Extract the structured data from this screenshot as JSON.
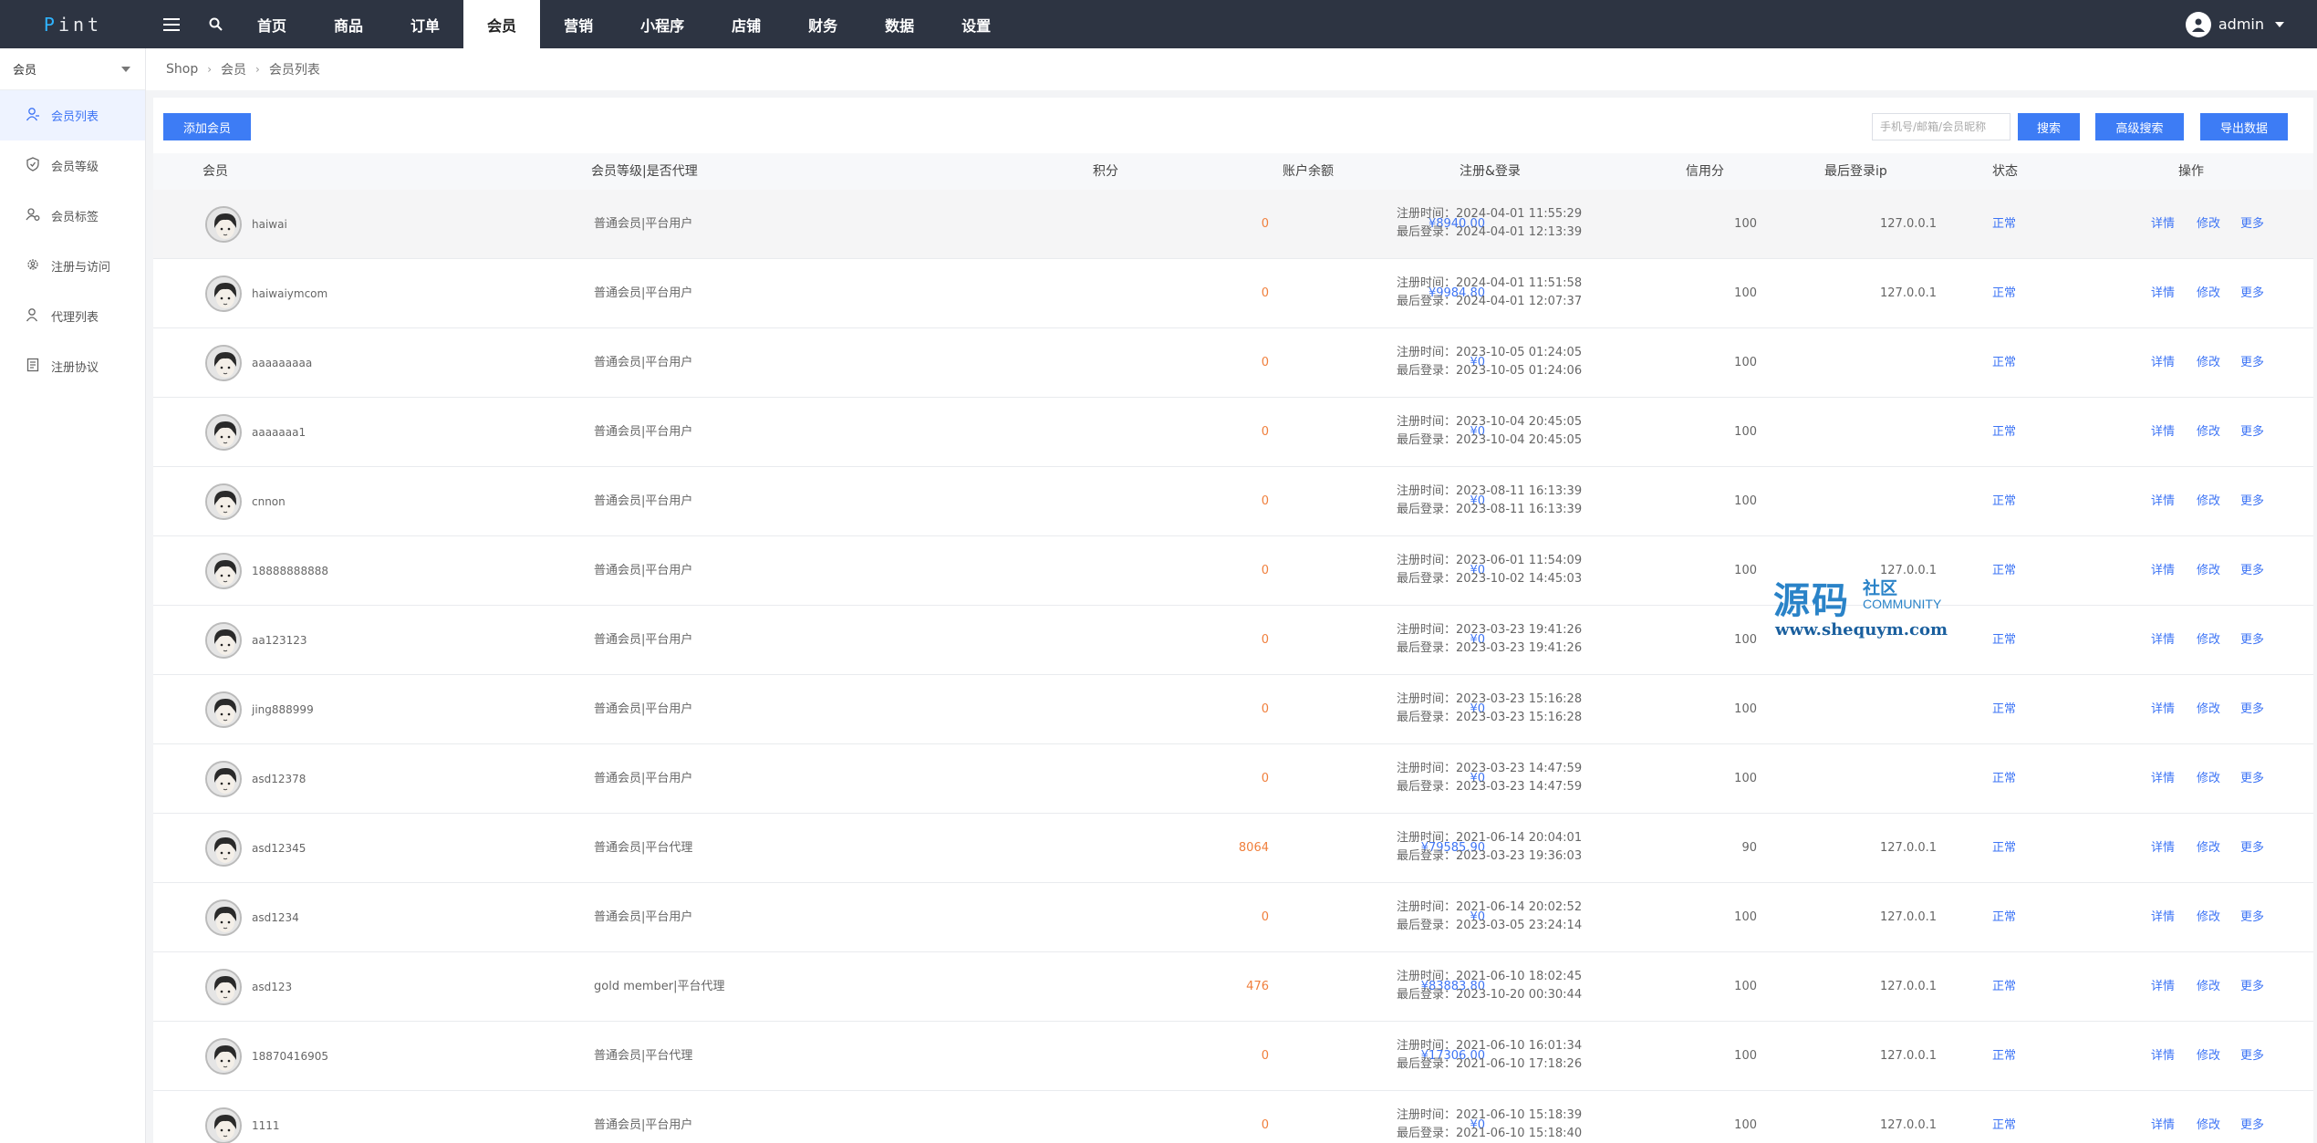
{
  "logo": "Pint",
  "nav": [
    "首页",
    "商品",
    "订单",
    "会员",
    "营销",
    "小程序",
    "店铺",
    "财务",
    "数据",
    "设置"
  ],
  "nav_active": 3,
  "user": "admin",
  "sidebar": {
    "header": "会员",
    "items": [
      {
        "label": "会员列表",
        "icon": "user-icon"
      },
      {
        "label": "会员等级",
        "icon": "shield-icon"
      },
      {
        "label": "会员标签",
        "icon": "user-tag-icon"
      },
      {
        "label": "注册与访问",
        "icon": "gear-user-icon"
      },
      {
        "label": "代理列表",
        "icon": "agent-icon"
      },
      {
        "label": "注册协议",
        "icon": "document-icon"
      }
    ]
  },
  "breadcrumb": [
    "Shop",
    "会员",
    "会员列表"
  ],
  "toolbar": {
    "add_label": "添加会员",
    "search_placeholder": "手机号/邮箱/会员昵称",
    "search_label": "搜索",
    "advanced_label": "高级搜索",
    "export_label": "导出数据"
  },
  "table": {
    "headers": [
      "会员",
      "会员等级|是否代理",
      "积分",
      "账户余额",
      "注册&登录",
      "信用分",
      "最后登录ip",
      "状态",
      "操作"
    ],
    "reg_prefix": "注册时间：",
    "login_prefix": "最后登录：",
    "actions": [
      "详情",
      "修改",
      "更多"
    ],
    "rows": [
      {
        "name": "haiwai",
        "level": "普通会员|平台用户",
        "points": "0",
        "balance": "¥8940.00",
        "reg": "2024-04-01 11:55:29",
        "login": "2024-04-01 12:13:39",
        "credit": "100",
        "ip": "127.0.0.1",
        "status": "正常"
      },
      {
        "name": "haiwaiymcom",
        "level": "普通会员|平台用户",
        "points": "0",
        "balance": "¥9984.80",
        "reg": "2024-04-01 11:51:58",
        "login": "2024-04-01 12:07:37",
        "credit": "100",
        "ip": "127.0.0.1",
        "status": "正常"
      },
      {
        "name": "aaaaaaaaa",
        "level": "普通会员|平台用户",
        "points": "0",
        "balance": "¥0",
        "reg": "2023-10-05 01:24:05",
        "login": "2023-10-05 01:24:06",
        "credit": "100",
        "ip": "",
        "status": "正常"
      },
      {
        "name": "aaaaaaa1",
        "level": "普通会员|平台用户",
        "points": "0",
        "balance": "¥0",
        "reg": "2023-10-04 20:45:05",
        "login": "2023-10-04 20:45:05",
        "credit": "100",
        "ip": "",
        "status": "正常"
      },
      {
        "name": "cnnon",
        "level": "普通会员|平台用户",
        "points": "0",
        "balance": "¥0",
        "reg": "2023-08-11 16:13:39",
        "login": "2023-08-11 16:13:39",
        "credit": "100",
        "ip": "",
        "status": "正常"
      },
      {
        "name": "18888888888",
        "level": "普通会员|平台用户",
        "points": "0",
        "balance": "¥0",
        "reg": "2023-06-01 11:54:09",
        "login": "2023-10-02 14:45:03",
        "credit": "100",
        "ip": "127.0.0.1",
        "status": "正常"
      },
      {
        "name": "aa123123",
        "level": "普通会员|平台用户",
        "points": "0",
        "balance": "¥0",
        "reg": "2023-03-23 19:41:26",
        "login": "2023-03-23 19:41:26",
        "credit": "100",
        "ip": "",
        "status": "正常"
      },
      {
        "name": "jing888999",
        "level": "普通会员|平台用户",
        "points": "0",
        "balance": "¥0",
        "reg": "2023-03-23 15:16:28",
        "login": "2023-03-23 15:16:28",
        "credit": "100",
        "ip": "",
        "status": "正常"
      },
      {
        "name": "asd12378",
        "level": "普通会员|平台用户",
        "points": "0",
        "balance": "¥0",
        "reg": "2023-03-23 14:47:59",
        "login": "2023-03-23 14:47:59",
        "credit": "100",
        "ip": "",
        "status": "正常"
      },
      {
        "name": "asd12345",
        "level": "普通会员|平台代理",
        "points": "8064",
        "balance": "¥79585.90",
        "reg": "2021-06-14 20:04:01",
        "login": "2023-03-23 19:36:03",
        "credit": "90",
        "ip": "127.0.0.1",
        "status": "正常"
      },
      {
        "name": "asd1234",
        "level": "普通会员|平台用户",
        "points": "0",
        "balance": "¥0",
        "reg": "2021-06-14 20:02:52",
        "login": "2023-03-05 23:24:14",
        "credit": "100",
        "ip": "127.0.0.1",
        "status": "正常"
      },
      {
        "name": "asd123",
        "level": "gold member|平台代理",
        "points": "476",
        "balance": "¥83883.80",
        "reg": "2021-06-10 18:02:45",
        "login": "2023-10-20 00:30:44",
        "credit": "100",
        "ip": "127.0.0.1",
        "status": "正常"
      },
      {
        "name": "18870416905",
        "level": "普通会员|平台代理",
        "points": "0",
        "balance": "¥17306.00",
        "reg": "2021-06-10 16:01:34",
        "login": "2021-06-10 17:18:26",
        "credit": "100",
        "ip": "127.0.0.1",
        "status": "正常"
      },
      {
        "name": "1111",
        "level": "普通会员|平台用户",
        "points": "0",
        "balance": "¥0",
        "reg": "2021-06-10 15:18:39",
        "login": "2021-06-10 15:18:40",
        "credit": "100",
        "ip": "127.0.0.1",
        "status": "正常"
      }
    ]
  },
  "watermark": {
    "big": "源码",
    "small": "社区",
    "community": "COMMUNITY",
    "url": "www.shequym.com"
  }
}
